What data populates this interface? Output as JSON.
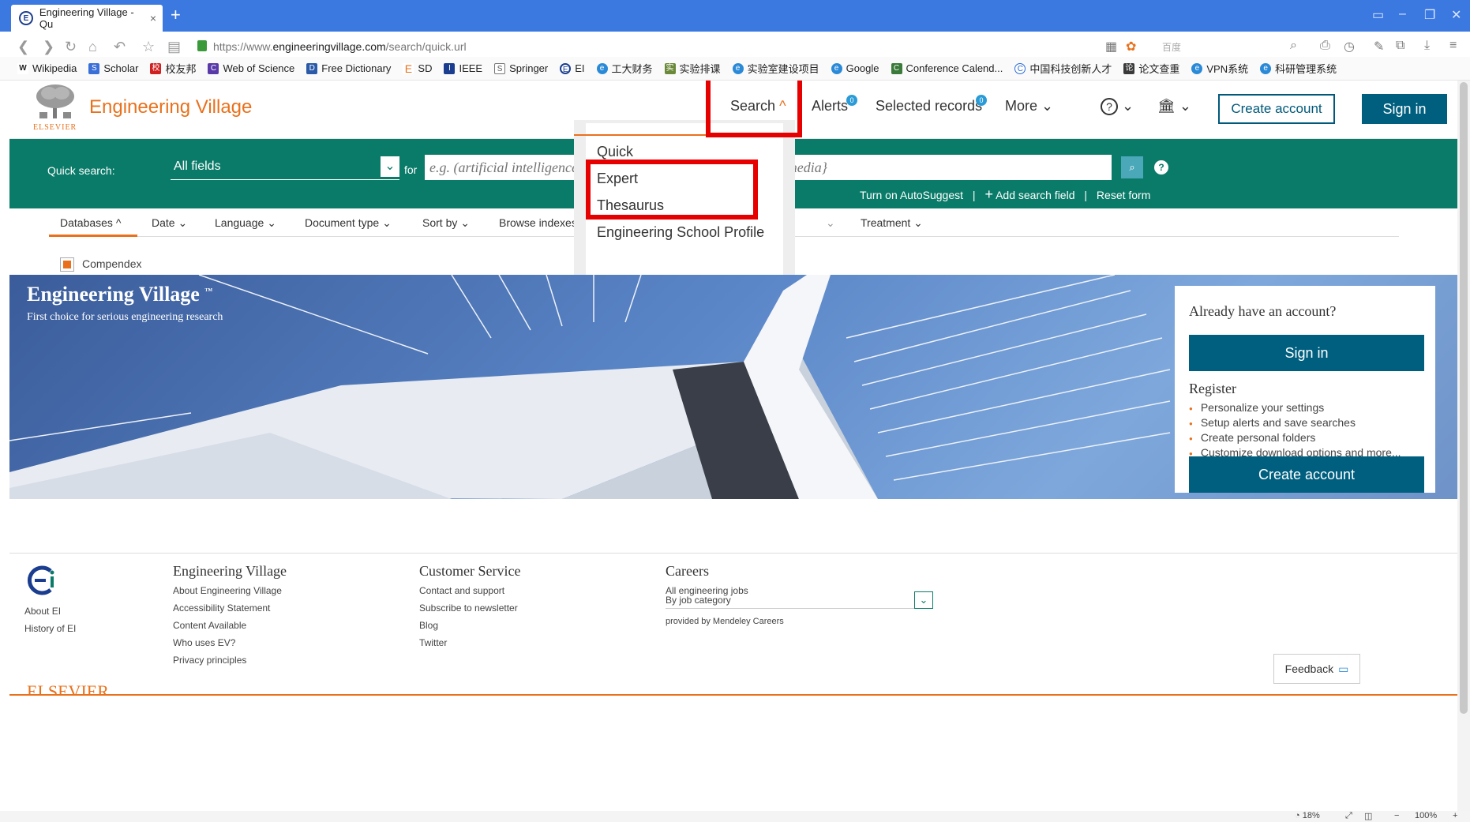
{
  "browser": {
    "tab_title": "Engineering Village - Qu",
    "tab_close": "×",
    "new_tab": "+",
    "url_prefix": "https://www.",
    "url_domain": "engineeringvillage.com",
    "url_path": "/search/quick.url",
    "search_engine": "百度",
    "bookmarks": [
      {
        "label": "Wikipedia",
        "icon": "W"
      },
      {
        "label": "Scholar",
        "icon": "S"
      },
      {
        "label": "校友邦",
        "icon": "校"
      },
      {
        "label": "Web of Science",
        "icon": "C"
      },
      {
        "label": "Free Dictionary",
        "icon": "D"
      },
      {
        "label": "SD",
        "icon": "E"
      },
      {
        "label": "IEEE",
        "icon": "I"
      },
      {
        "label": "Springer",
        "icon": "S"
      },
      {
        "label": "EI",
        "icon": "E"
      },
      {
        "label": "工大财务",
        "icon": "e"
      },
      {
        "label": "实验排课",
        "icon": "实"
      },
      {
        "label": "实验室建设项目",
        "icon": "e"
      },
      {
        "label": "Google",
        "icon": "e"
      },
      {
        "label": "Conference Calend...",
        "icon": "C"
      },
      {
        "label": "中国科技创新人才",
        "icon": "C"
      },
      {
        "label": "论文查重",
        "icon": "论"
      },
      {
        "label": "VPN系统",
        "icon": "e"
      },
      {
        "label": "科研管理系统",
        "icon": "e"
      }
    ],
    "status": {
      "zoom_percent": "18%",
      "zoom": "100%",
      "minus": "−",
      "plus": "+"
    }
  },
  "header": {
    "brand_small": "ELSEVIER",
    "title": "Engineering Village",
    "nav": {
      "search": "Search",
      "alerts": "Alerts",
      "alerts_badge": "0",
      "selected": "Selected records",
      "selected_badge": "0",
      "more": "More"
    },
    "create_account": "Create account",
    "sign_in": "Sign in"
  },
  "search_menu": {
    "items": [
      "Quick",
      "Expert",
      "Thesaurus",
      "Engineering School Profile"
    ]
  },
  "quick_search": {
    "label": "Quick search:",
    "field_value": "All fields",
    "for_label": "for",
    "placeholder": "e.g. (artificial intelligence OR machine learning) AND {social media}",
    "links": {
      "autosuggest": "Turn on AutoSuggest",
      "sep": "|",
      "add_field": "Add search field",
      "reset": "Reset form"
    }
  },
  "filters": {
    "items": [
      "Databases",
      "Date",
      "Language",
      "Document type",
      "Sort by",
      "Browse indexes",
      "Treatment"
    ],
    "database": "Compendex"
  },
  "hero": {
    "title": "Engineering Village",
    "tm": "™",
    "subtitle": "First choice for serious engineering research"
  },
  "account_card": {
    "title": "Already have an account?",
    "sign_in": "Sign in",
    "register": "Register",
    "benefits": [
      "Personalize your settings",
      "Setup alerts and save searches",
      "Create personal folders",
      "Customize download options and more..."
    ],
    "create": "Create account"
  },
  "footer": {
    "about_ei": "About EI",
    "history_ei": "History of EI",
    "ev_head": "Engineering Village",
    "ev_links": [
      "About Engineering Village",
      "Accessibility Statement",
      "Content Available",
      "Who uses EV?",
      "Privacy principles"
    ],
    "cs_head": "Customer Service",
    "cs_links": [
      "Contact and support",
      "Subscribe to newsletter",
      "Blog",
      "Twitter"
    ],
    "careers_head": "Careers",
    "careers_jobs": "All engineering jobs",
    "careers_category": "By job category",
    "careers_provided": "provided by Mendeley Careers",
    "brand": "ELSEVIER",
    "feedback": "Feedback"
  },
  "colors": {
    "brand_orange": "#e9711c",
    "teal_band": "#0b7b69",
    "primary_button": "#005f7f",
    "highlight_red": "#e60000"
  }
}
